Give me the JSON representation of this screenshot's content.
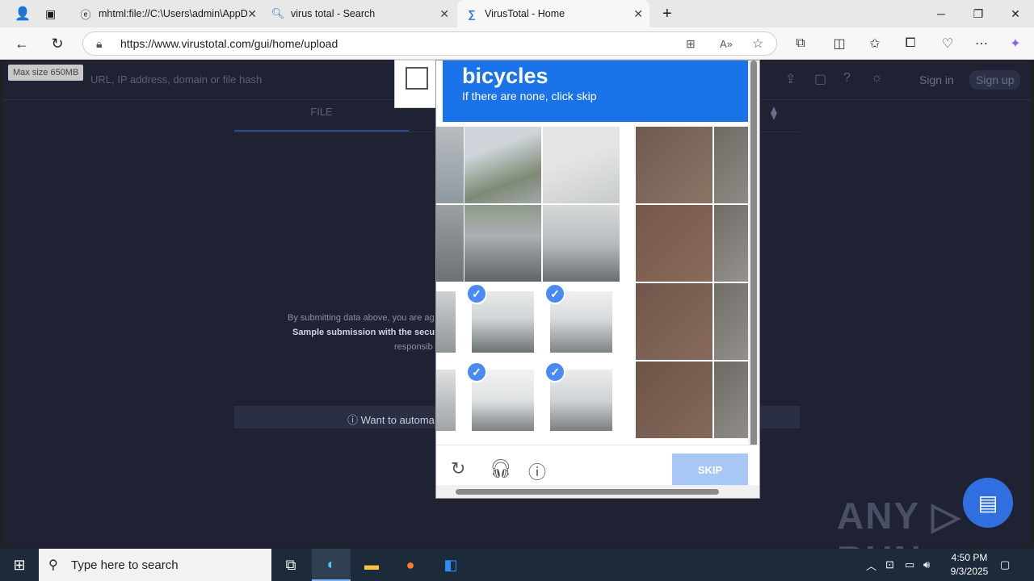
{
  "browser": {
    "tabs": [
      {
        "label": "mhtml:file://C:\\Users\\admin\\AppD",
        "icon": "ie-icon"
      },
      {
        "label": "virus total - Search",
        "icon": "search-icon"
      },
      {
        "label": "VirusTotal - Home",
        "icon": "virustotal-icon"
      }
    ],
    "url": "https://www.virustotal.com/gui/home/upload"
  },
  "vt": {
    "max_size": "Max size 650MB",
    "search_placeholder": "URL, IP address, domain or file hash",
    "sign_in": "Sign in",
    "sign_up": "Sign up",
    "file_tab": "FILE",
    "notice1": "By submitting data above, you are ag",
    "notice2": "Sample submission with the secu",
    "notice3": "responsib",
    "want_automate": "ⓘ Want to automa"
  },
  "captcha": {
    "target_word": "bicycles",
    "instruction": "If there are none, click skip",
    "skip_label": "SKIP"
  },
  "watermark": "ANY ▷ RUN",
  "taskbar": {
    "search_placeholder": "Type here to search",
    "time": "4:50 PM",
    "date": "9/3/2025"
  },
  "colors": {
    "captcha_blue": "#1a73e8",
    "skip_disabled": "#a7c7f5",
    "vt_background": "#1f2233"
  }
}
